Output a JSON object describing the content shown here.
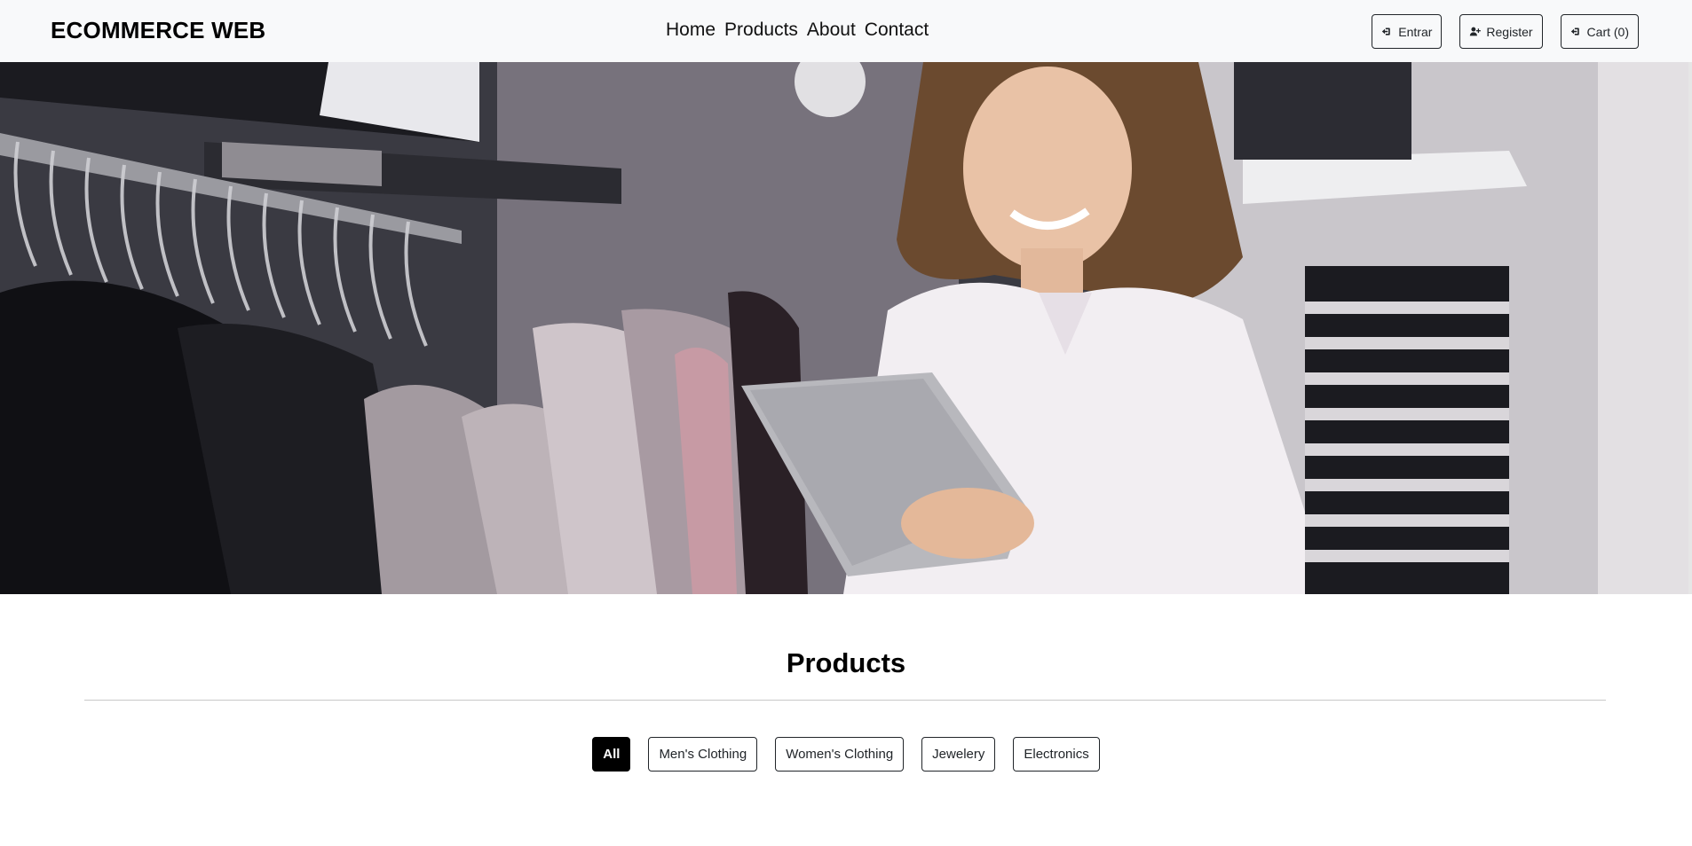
{
  "navbar": {
    "brand": "ECOMMERCE WEB",
    "links": [
      "Home",
      "Products",
      "About",
      "Contact"
    ],
    "buttons": {
      "login": "Entrar",
      "register": "Register",
      "cart": "Cart (0)"
    },
    "icons": {
      "login": "sign-in-icon",
      "register": "user-plus-icon",
      "cart": "sign-in-icon"
    }
  },
  "hero": {
    "image": "woman-with-tablet-in-clothing-store"
  },
  "products": {
    "title": "Products",
    "filters": [
      "All",
      "Men's Clothing",
      "Women's Clothing",
      "Jewelery",
      "Electronics"
    ],
    "active_filter": "All"
  },
  "colors": {
    "navbar_bg": "#f8f9fa",
    "text": "#212529",
    "active_filter_bg": "#000000",
    "page_bg": "#ffffff"
  }
}
